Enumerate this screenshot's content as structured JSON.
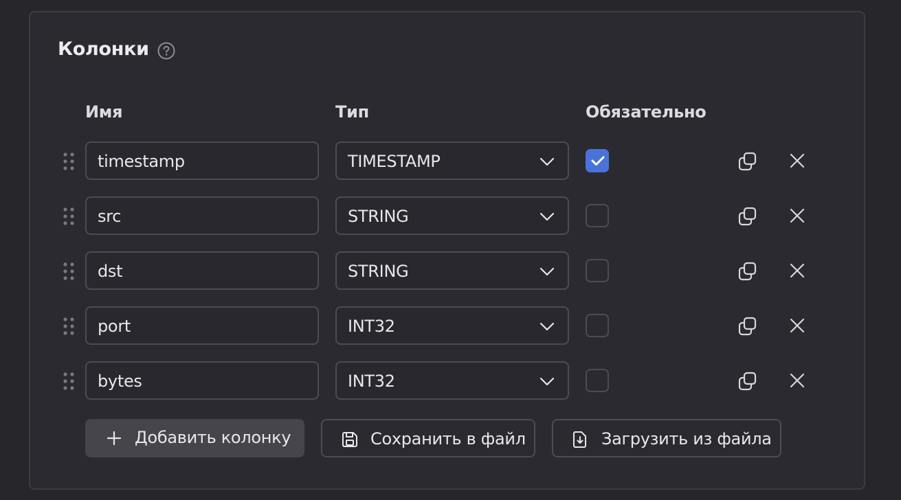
{
  "section": {
    "title": "Колонки",
    "help_icon": "question-circle-icon"
  },
  "headers": {
    "name": "Имя",
    "type": "Тип",
    "required": "Обязательно"
  },
  "columns": [
    {
      "name": "timestamp",
      "type": "TIMESTAMP",
      "required": true
    },
    {
      "name": "src",
      "type": "STRING",
      "required": false
    },
    {
      "name": "dst",
      "type": "STRING",
      "required": false
    },
    {
      "name": "port",
      "type": "INT32",
      "required": false
    },
    {
      "name": "bytes",
      "type": "INT32",
      "required": false
    }
  ],
  "actions": {
    "add": "Добавить колонку",
    "save": "Сохранить в файл",
    "load": "Загрузить из файла"
  },
  "colors": {
    "accent": "#4a73d8",
    "background": "#27262b",
    "panel": "#2b2a30"
  }
}
